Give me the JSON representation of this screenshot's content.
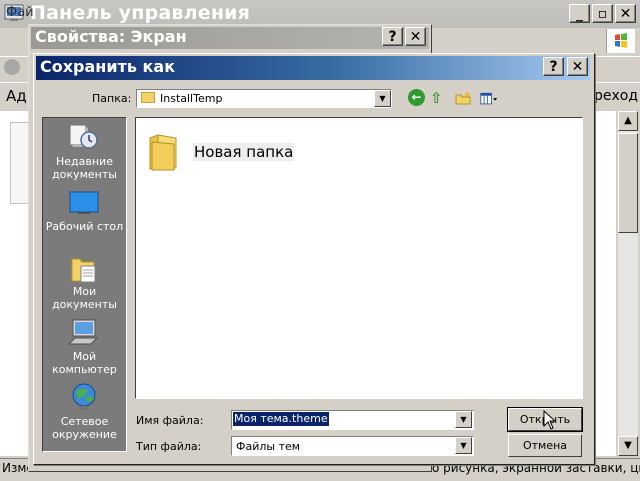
{
  "control_panel": {
    "title": "Панель управления",
    "menu_file": "Фай",
    "address_label": "Ад",
    "goto_label": "реход",
    "status_left": "Изме",
    "status_right": "о рисунка, экранной заставки, цвет"
  },
  "display_properties": {
    "title": "Свойства: Экран"
  },
  "save_as": {
    "title": "Сохранить как",
    "folder_label": "Папка:",
    "folder_value": "InstallTemp",
    "places": [
      {
        "label": "Недавние документы",
        "icon": "recent-documents-icon"
      },
      {
        "label": "Рабочий стол",
        "icon": "desktop-icon"
      },
      {
        "label": "Мои документы",
        "icon": "my-documents-icon"
      },
      {
        "label": "Мой компьютер",
        "icon": "my-computer-icon"
      },
      {
        "label": "Сетевое окружение",
        "icon": "network-icon"
      }
    ],
    "items": [
      {
        "label": "Новая папка",
        "icon": "folder-icon"
      }
    ],
    "filename_label": "Имя файла:",
    "filename_value": "Моя тема.theme",
    "filetype_label": "Тип файла:",
    "filetype_value": "Файлы тем",
    "open_label": "Открыть",
    "cancel_label": "Отмена"
  },
  "colors": {
    "titlebar_active": "#0a246a",
    "titlebar_inactive": "#9a9894",
    "dialog_face": "#d4d0c8",
    "places_bar": "#7b7b7b"
  }
}
